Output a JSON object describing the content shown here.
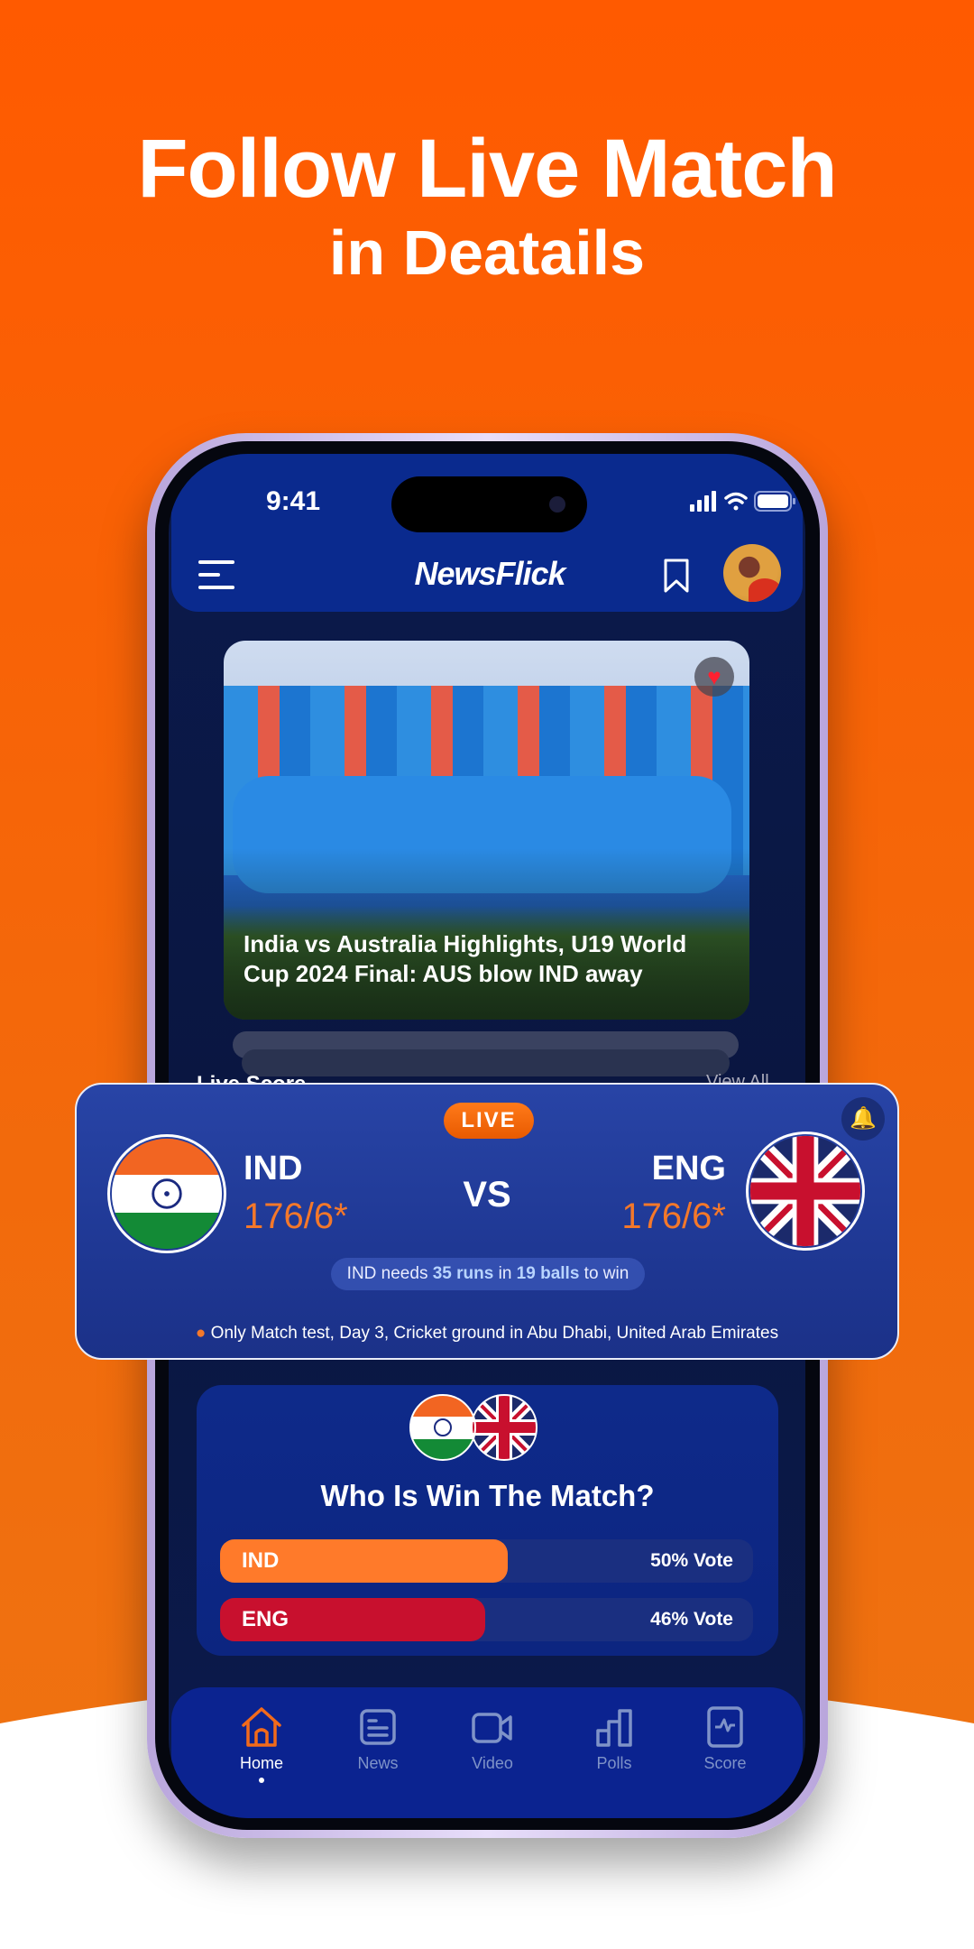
{
  "hero": {
    "line1": "Follow Live Match",
    "line2": "in Deatails"
  },
  "status_bar": {
    "time": "9:41"
  },
  "header": {
    "app_name": "NewsFlick",
    "menu_icon": "hamburger-icon",
    "bookmark_icon": "bookmark-icon"
  },
  "news_card": {
    "caption": "India vs Australia Highlights, U19 World Cup 2024 Final: AUS blow IND away",
    "favorite_icon": "heart-icon"
  },
  "live_section": {
    "title": "Live Score",
    "view_all": "View All"
  },
  "live_match": {
    "badge": "LIVE",
    "vs": "VS",
    "team1": {
      "name": "IND",
      "score": "176/6*"
    },
    "team2": {
      "name": "ENG",
      "score": "176/6*"
    },
    "needs": {
      "pre": "IND needs ",
      "runs": "35 runs",
      "mid": " in ",
      "balls": "19 balls",
      "post": " to win"
    },
    "location": "Only Match test, Day 3, Cricket ground in Abu Dhabi, United Arab Emirates"
  },
  "poll": {
    "question": "Who Is Win The Match?",
    "options": [
      {
        "label": "IND",
        "percent": 50,
        "vote_text": "50% Vote",
        "color": "#ff7a2a"
      },
      {
        "label": "ENG",
        "percent": 46,
        "vote_text": "46% Vote",
        "color": "#c8102e"
      }
    ]
  },
  "nav": {
    "items": [
      {
        "label": "Home",
        "icon": "home-icon",
        "active": true
      },
      {
        "label": "News",
        "icon": "news-icon"
      },
      {
        "label": "Video",
        "icon": "video-icon"
      },
      {
        "label": "Polls",
        "icon": "polls-icon"
      },
      {
        "label": "Score",
        "icon": "score-icon"
      }
    ]
  },
  "colors": {
    "accent": "#f4782a",
    "brand_blue": "#0a2a8e",
    "background": "#ff5a00"
  }
}
